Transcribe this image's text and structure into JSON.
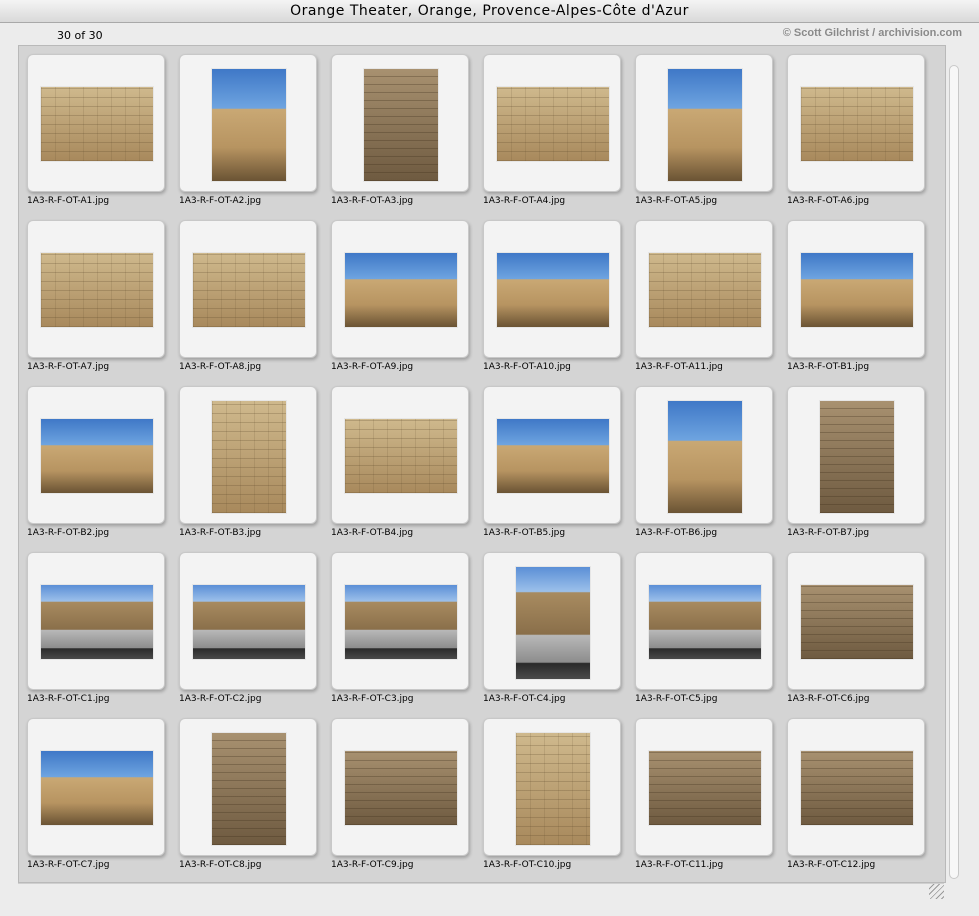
{
  "window": {
    "title": "Orange Theater, Orange, Provence-Alpes-Côte d'Azur"
  },
  "info": {
    "count": "30 of 30",
    "credit": "© Scott Gilchrist / archivision.com"
  },
  "items": [
    {
      "file": "1A3-R-F-OT-A1.jpg",
      "orient": "landscape",
      "style": "stone"
    },
    {
      "file": "1A3-R-F-OT-A2.jpg",
      "orient": "portrait",
      "style": "sky"
    },
    {
      "file": "1A3-R-F-OT-A3.jpg",
      "orient": "portrait",
      "style": "stonedark"
    },
    {
      "file": "1A3-R-F-OT-A4.jpg",
      "orient": "landscape",
      "style": "stone"
    },
    {
      "file": "1A3-R-F-OT-A5.jpg",
      "orient": "portrait",
      "style": "sky"
    },
    {
      "file": "1A3-R-F-OT-A6.jpg",
      "orient": "landscape",
      "style": "stone"
    },
    {
      "file": "1A3-R-F-OT-A7.jpg",
      "orient": "landscape",
      "style": "stone"
    },
    {
      "file": "1A3-R-F-OT-A8.jpg",
      "orient": "landscape",
      "style": "stone"
    },
    {
      "file": "1A3-R-F-OT-A9.jpg",
      "orient": "landscape",
      "style": "sky"
    },
    {
      "file": "1A3-R-F-OT-A10.jpg",
      "orient": "landscape",
      "style": "sky"
    },
    {
      "file": "1A3-R-F-OT-A11.jpg",
      "orient": "landscape",
      "style": "stone"
    },
    {
      "file": "1A3-R-F-OT-B1.jpg",
      "orient": "landscape",
      "style": "sky"
    },
    {
      "file": "1A3-R-F-OT-B2.jpg",
      "orient": "landscape",
      "style": "sky"
    },
    {
      "file": "1A3-R-F-OT-B3.jpg",
      "orient": "portrait",
      "style": "stone"
    },
    {
      "file": "1A3-R-F-OT-B4.jpg",
      "orient": "landscape",
      "style": "stone"
    },
    {
      "file": "1A3-R-F-OT-B5.jpg",
      "orient": "landscape",
      "style": "sky"
    },
    {
      "file": "1A3-R-F-OT-B6.jpg",
      "orient": "portrait",
      "style": "sky"
    },
    {
      "file": "1A3-R-F-OT-B7.jpg",
      "orient": "portrait",
      "style": "stonedark"
    },
    {
      "file": "1A3-R-F-OT-C1.jpg",
      "orient": "landscape",
      "style": "theater"
    },
    {
      "file": "1A3-R-F-OT-C2.jpg",
      "orient": "landscape",
      "style": "theater"
    },
    {
      "file": "1A3-R-F-OT-C3.jpg",
      "orient": "landscape",
      "style": "theater"
    },
    {
      "file": "1A3-R-F-OT-C4.jpg",
      "orient": "portrait",
      "style": "theater"
    },
    {
      "file": "1A3-R-F-OT-C5.jpg",
      "orient": "landscape",
      "style": "theater"
    },
    {
      "file": "1A3-R-F-OT-C6.jpg",
      "orient": "landscape",
      "style": "stonedark"
    },
    {
      "file": "1A3-R-F-OT-C7.jpg",
      "orient": "landscape",
      "style": "sky"
    },
    {
      "file": "1A3-R-F-OT-C8.jpg",
      "orient": "portrait",
      "style": "stonedark"
    },
    {
      "file": "1A3-R-F-OT-C9.jpg",
      "orient": "landscape",
      "style": "stonedark"
    },
    {
      "file": "1A3-R-F-OT-C10.jpg",
      "orient": "portrait",
      "style": "stone"
    },
    {
      "file": "1A3-R-F-OT-C11.jpg",
      "orient": "landscape",
      "style": "stonedark"
    },
    {
      "file": "1A3-R-F-OT-C12.jpg",
      "orient": "landscape",
      "style": "stonedark"
    }
  ]
}
